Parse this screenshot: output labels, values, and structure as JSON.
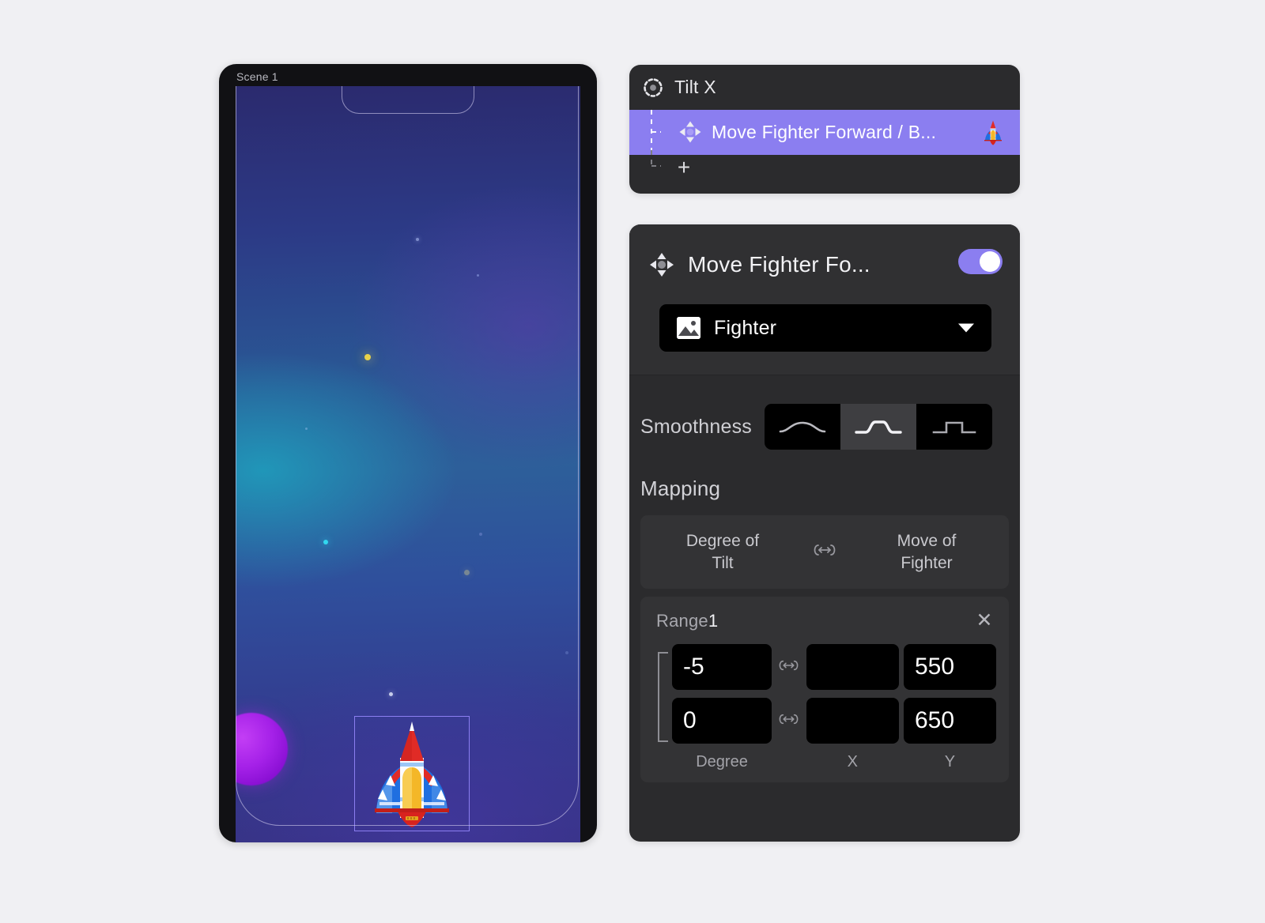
{
  "canvas": {
    "background_color": "#f0f0f3",
    "scene_label": "Scene 1",
    "sprite": {
      "name": "Fighter",
      "icon": "rocket-sprite",
      "selected": true
    }
  },
  "action_list": {
    "header": {
      "icon": "gyroscope-sensor-icon",
      "title": "Tilt X"
    },
    "rows": [
      {
        "icon": "move-four-arrows-icon",
        "label": "Move Fighter Forward / B...",
        "thumbnail": "rocket-thumbnail",
        "selected": true,
        "highlight_color": "#8b7ef0"
      }
    ],
    "add_button_label": "+"
  },
  "properties": {
    "icon": "move-four-arrows-icon",
    "title": "Move Fighter Fo...",
    "enabled": true,
    "toggle_color": "#8b7ef0",
    "target": {
      "icon": "image-thumbnail-icon",
      "value": "Fighter",
      "caret": "chevron-down-icon"
    },
    "smoothness": {
      "label": "Smoothness",
      "options": [
        {
          "id": "smooth-curve",
          "icon": "smooth-hill-curve-icon",
          "selected": false
        },
        {
          "id": "rounded-step",
          "icon": "rounded-step-curve-icon",
          "selected": true
        },
        {
          "id": "sharp-step",
          "icon": "sharp-step-curve-icon",
          "selected": false
        }
      ]
    },
    "mapping": {
      "label": "Mapping",
      "header": {
        "left": "Degree of\nTilt",
        "left_line1": "Degree of",
        "left_line2": "Tilt",
        "link_icon": "bidirectional-link-icon",
        "right_line1": "Move of",
        "right_line2": "Fighter"
      },
      "ranges": [
        {
          "name": "Range",
          "number": "1",
          "close_label": "✕",
          "rows": [
            {
              "degree": "-5",
              "x": "",
              "y": "550"
            },
            {
              "degree": "0",
              "x": "",
              "y": "650"
            }
          ],
          "axis_labels": {
            "degree": "Degree",
            "x": "X",
            "y": "Y"
          }
        }
      ]
    }
  }
}
